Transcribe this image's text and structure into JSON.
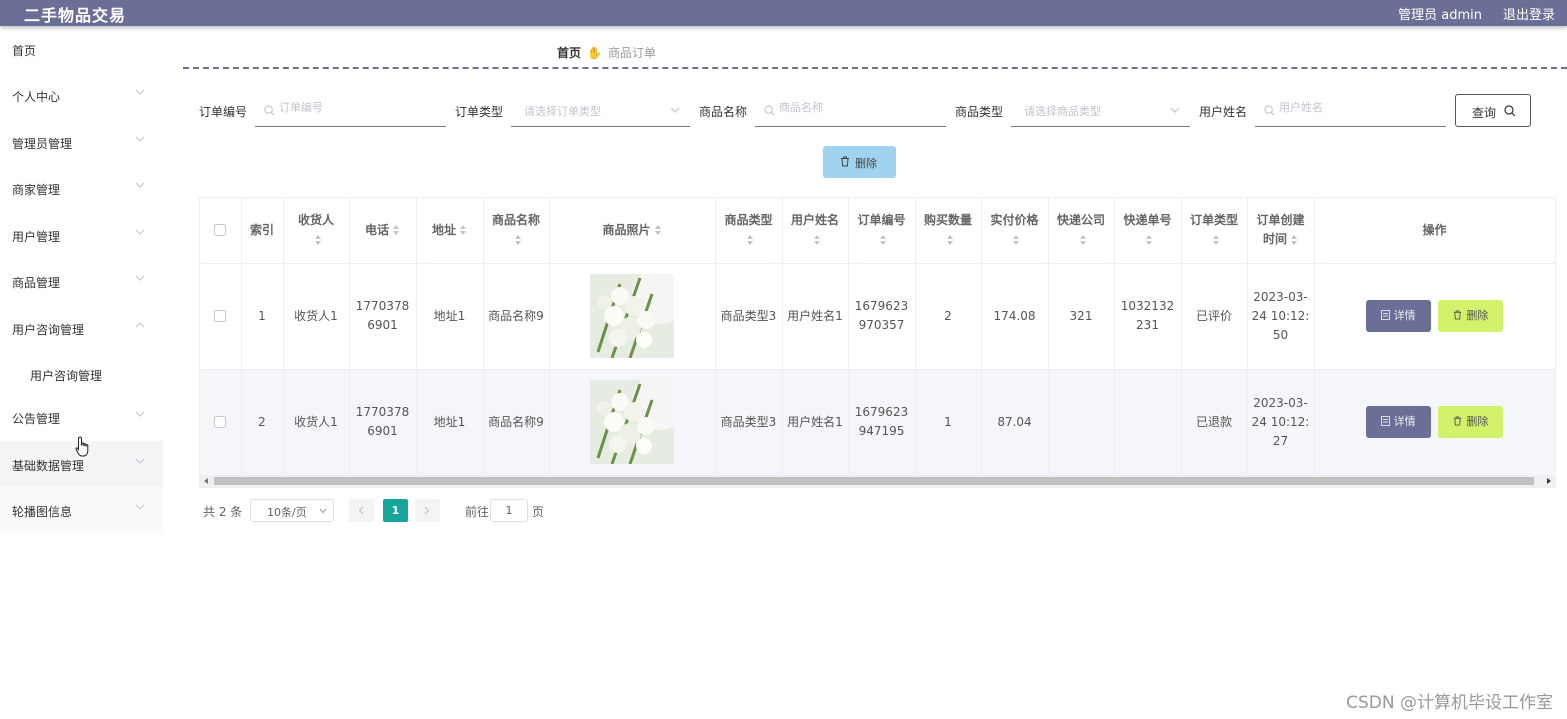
{
  "app": {
    "title": "二手物品交易",
    "user": "管理员 admin",
    "logout": "退出登录"
  },
  "sidebar": {
    "items": [
      {
        "label": "首页"
      },
      {
        "label": "个人中心"
      },
      {
        "label": "管理员管理"
      },
      {
        "label": "商家管理"
      },
      {
        "label": "用户管理"
      },
      {
        "label": "商品管理"
      },
      {
        "label": "用户咨询管理"
      },
      {
        "label": "公告管理"
      },
      {
        "label": "基础数据管理"
      },
      {
        "label": "轮播图信息"
      }
    ],
    "sub_item": "用户咨询管理"
  },
  "breadcrumb": {
    "home": "首页",
    "current": "商品订单"
  },
  "search": {
    "order_no_label": "订单编号",
    "order_no_placeholder": "订单编号",
    "order_type_label": "订单类型",
    "order_type_placeholder": "请选择订单类型",
    "goods_name_label": "商品名称",
    "goods_name_placeholder": "商品名称",
    "goods_type_label": "商品类型",
    "goods_type_placeholder": "请选择商品类型",
    "user_name_label": "用户姓名",
    "user_name_placeholder": "用户姓名",
    "query_button": "查询"
  },
  "toolbar": {
    "delete_label": "删除"
  },
  "table": {
    "headers": {
      "index": "索引",
      "receiver": "收货人",
      "phone": "电话",
      "address": "地址",
      "goods_name": "商品名称",
      "goods_photo": "商品照片",
      "goods_type": "商品类型",
      "user_name": "用户姓名",
      "order_no": "订单编号",
      "quantity": "购买数量",
      "price": "实付价格",
      "courier": "快递公司",
      "tracking_no": "快递单号",
      "order_type": "订单类型",
      "created_at": "订单创建时间",
      "actions": "操作"
    },
    "rows": [
      {
        "index": "1",
        "receiver": "收货人1",
        "phone": "17703786901",
        "address": "地址1",
        "goods_name": "商品名称9",
        "goods_type": "商品类型3",
        "user_name": "用户姓名1",
        "order_no": "1679623970357",
        "quantity": "2",
        "price": "174.08",
        "courier": "321",
        "tracking_no": "1032132231",
        "order_type": "已评价",
        "created_at": "2023-03-24 10:12:50",
        "detail": "详情",
        "delete": "删除"
      },
      {
        "index": "2",
        "receiver": "收货人1",
        "phone": "17703786901",
        "address": "地址1",
        "goods_name": "商品名称9",
        "goods_type": "商品类型3",
        "user_name": "用户姓名1",
        "order_no": "1679623947195",
        "quantity": "1",
        "price": "87.04",
        "courier": "",
        "tracking_no": "",
        "order_type": "已退款",
        "created_at": "2023-03-24 10:12:27",
        "detail": "详情",
        "delete": "删除"
      }
    ]
  },
  "pagination": {
    "total": "共 2 条",
    "page_size": "10条/页",
    "current_page": "1",
    "goto_prefix": "前往",
    "goto_value": "1",
    "goto_suffix": "页"
  },
  "watermark": "CSDN @计算机毕设工作室",
  "colors": {
    "header_bg": "#6b6e96",
    "delete_top": "#9fd3ef",
    "detail_button": "#6b6e96",
    "delete_button": "#d2f26b",
    "page_active": "#15a59a"
  }
}
